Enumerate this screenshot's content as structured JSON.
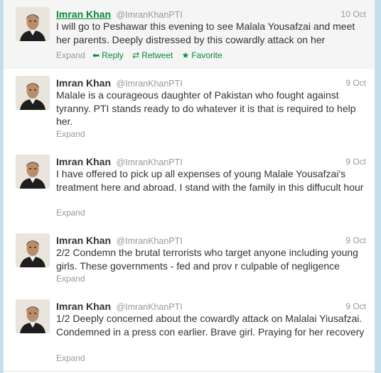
{
  "tweets": [
    {
      "name": "Imran Khan",
      "handle": "@ImranKhanPTI",
      "time": "10 Oct",
      "text": "I will go to Peshawar this evening to see Malala Yousafzai and meet her parents. Deeply distressed by this cowardly attack on her",
      "expand": "Expand",
      "reply": "Reply",
      "retweet": "Retweet",
      "favorite": "Favorite"
    },
    {
      "name": "Imran Khan",
      "handle": "@ImranKhanPTI",
      "time": "9 Oct",
      "text": "Malale is a courageous daughter of Pakistan who fought against tyranny. PTI stands ready to do whatever it is that is required to help her.",
      "expand": "Expand"
    },
    {
      "name": "Imran Khan",
      "handle": "@ImranKhanPTI",
      "time": "9 Oct",
      "text": "I have offered to pick up all expenses of young Malale Yousafzai's treatment here and abroad. I stand with the family in this diffucult hour",
      "expand": "Expand"
    },
    {
      "name": "Imran Khan",
      "handle": "@ImranKhanPTI",
      "time": "9 Oct",
      "text": "2/2 Condemn the brutal terrorists who target anyone including young girls. These governments - fed and prov r culpable of negligence",
      "expand": "Expand"
    },
    {
      "name": "Imran Khan",
      "handle": "@ImranKhanPTI",
      "time": "9 Oct",
      "text": "1/2 Deeply concerned about the cowardly attack on Malalai Yiusafzai. Condemned in a press con earlier. Brave girl. Praying for her recovery",
      "expand": "Expand"
    }
  ],
  "colors": {
    "background": "#c0deed",
    "action_green": "#0a8a3a",
    "meta_gray": "#999999",
    "text": "#333333"
  },
  "icons": {
    "reply": "reply-arrow-icon",
    "retweet": "retweet-icon",
    "favorite": "star-icon"
  }
}
